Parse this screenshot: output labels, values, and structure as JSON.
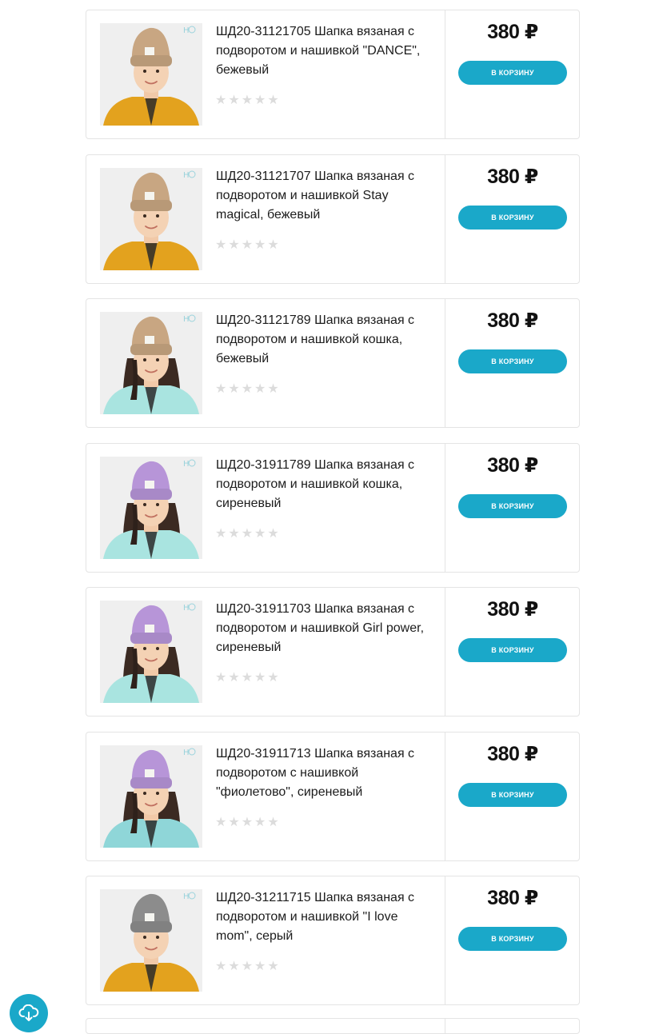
{
  "products": [
    {
      "title": "ШД20-31121705 Шапка вязаная с подворотом и нашивкой \"DANCE\", бежевый",
      "price": "380 ₽",
      "button_label": "В корзину",
      "rating": 0,
      "hat_color": "#c8a682",
      "jacket_color": "#e3a21e",
      "hair": "short"
    },
    {
      "title": "ШД20-31121707 Шапка вязаная с подворотом и нашивкой Stay magical, бежевый",
      "price": "380 ₽",
      "button_label": "В корзину",
      "rating": 0,
      "hat_color": "#c8a682",
      "jacket_color": "#e3a21e",
      "hair": "short"
    },
    {
      "title": "ШД20-31121789 Шапка вязаная с подворотом и нашивкой кошка, бежевый",
      "price": "380 ₽",
      "button_label": "В корзину",
      "rating": 0,
      "hat_color": "#c8a682",
      "jacket_color": "#a9e4e0",
      "hair": "long"
    },
    {
      "title": "ШД20-31911789 Шапка вязаная с подворотом и нашивкой кошка, сиреневый",
      "price": "380 ₽",
      "button_label": "В корзину",
      "rating": 0,
      "hat_color": "#b795d8",
      "jacket_color": "#a9e4e0",
      "hair": "long"
    },
    {
      "title": "ШД20-31911703 Шапка вязаная с подворотом и нашивкой Girl power, сиреневый",
      "price": "380 ₽",
      "button_label": "В корзину",
      "rating": 0,
      "hat_color": "#b795d8",
      "jacket_color": "#a9e4e0",
      "hair": "long"
    },
    {
      "title": "ШД20-31911713 Шапка вязаная с подворотом с нашивкой \"фиолетово\", сиреневый",
      "price": "380 ₽",
      "button_label": "В корзину",
      "rating": 0,
      "hat_color": "#b795d8",
      "jacket_color": "#8fd6d8",
      "hair": "long"
    },
    {
      "title": "ШД20-31211715 Шапка вязаная с подворотом и нашивкой \"I love mom\", серый",
      "price": "380 ₽",
      "button_label": "В корзину",
      "rating": 0,
      "hat_color": "#8c8c8c",
      "jacket_color": "#e3a21e",
      "hair": "short"
    }
  ],
  "colors": {
    "accent": "#1aa8c9",
    "star_empty": "#dcdcdc",
    "border": "#e4e4e4"
  },
  "fab": {
    "icon": "cloud-download-icon"
  }
}
